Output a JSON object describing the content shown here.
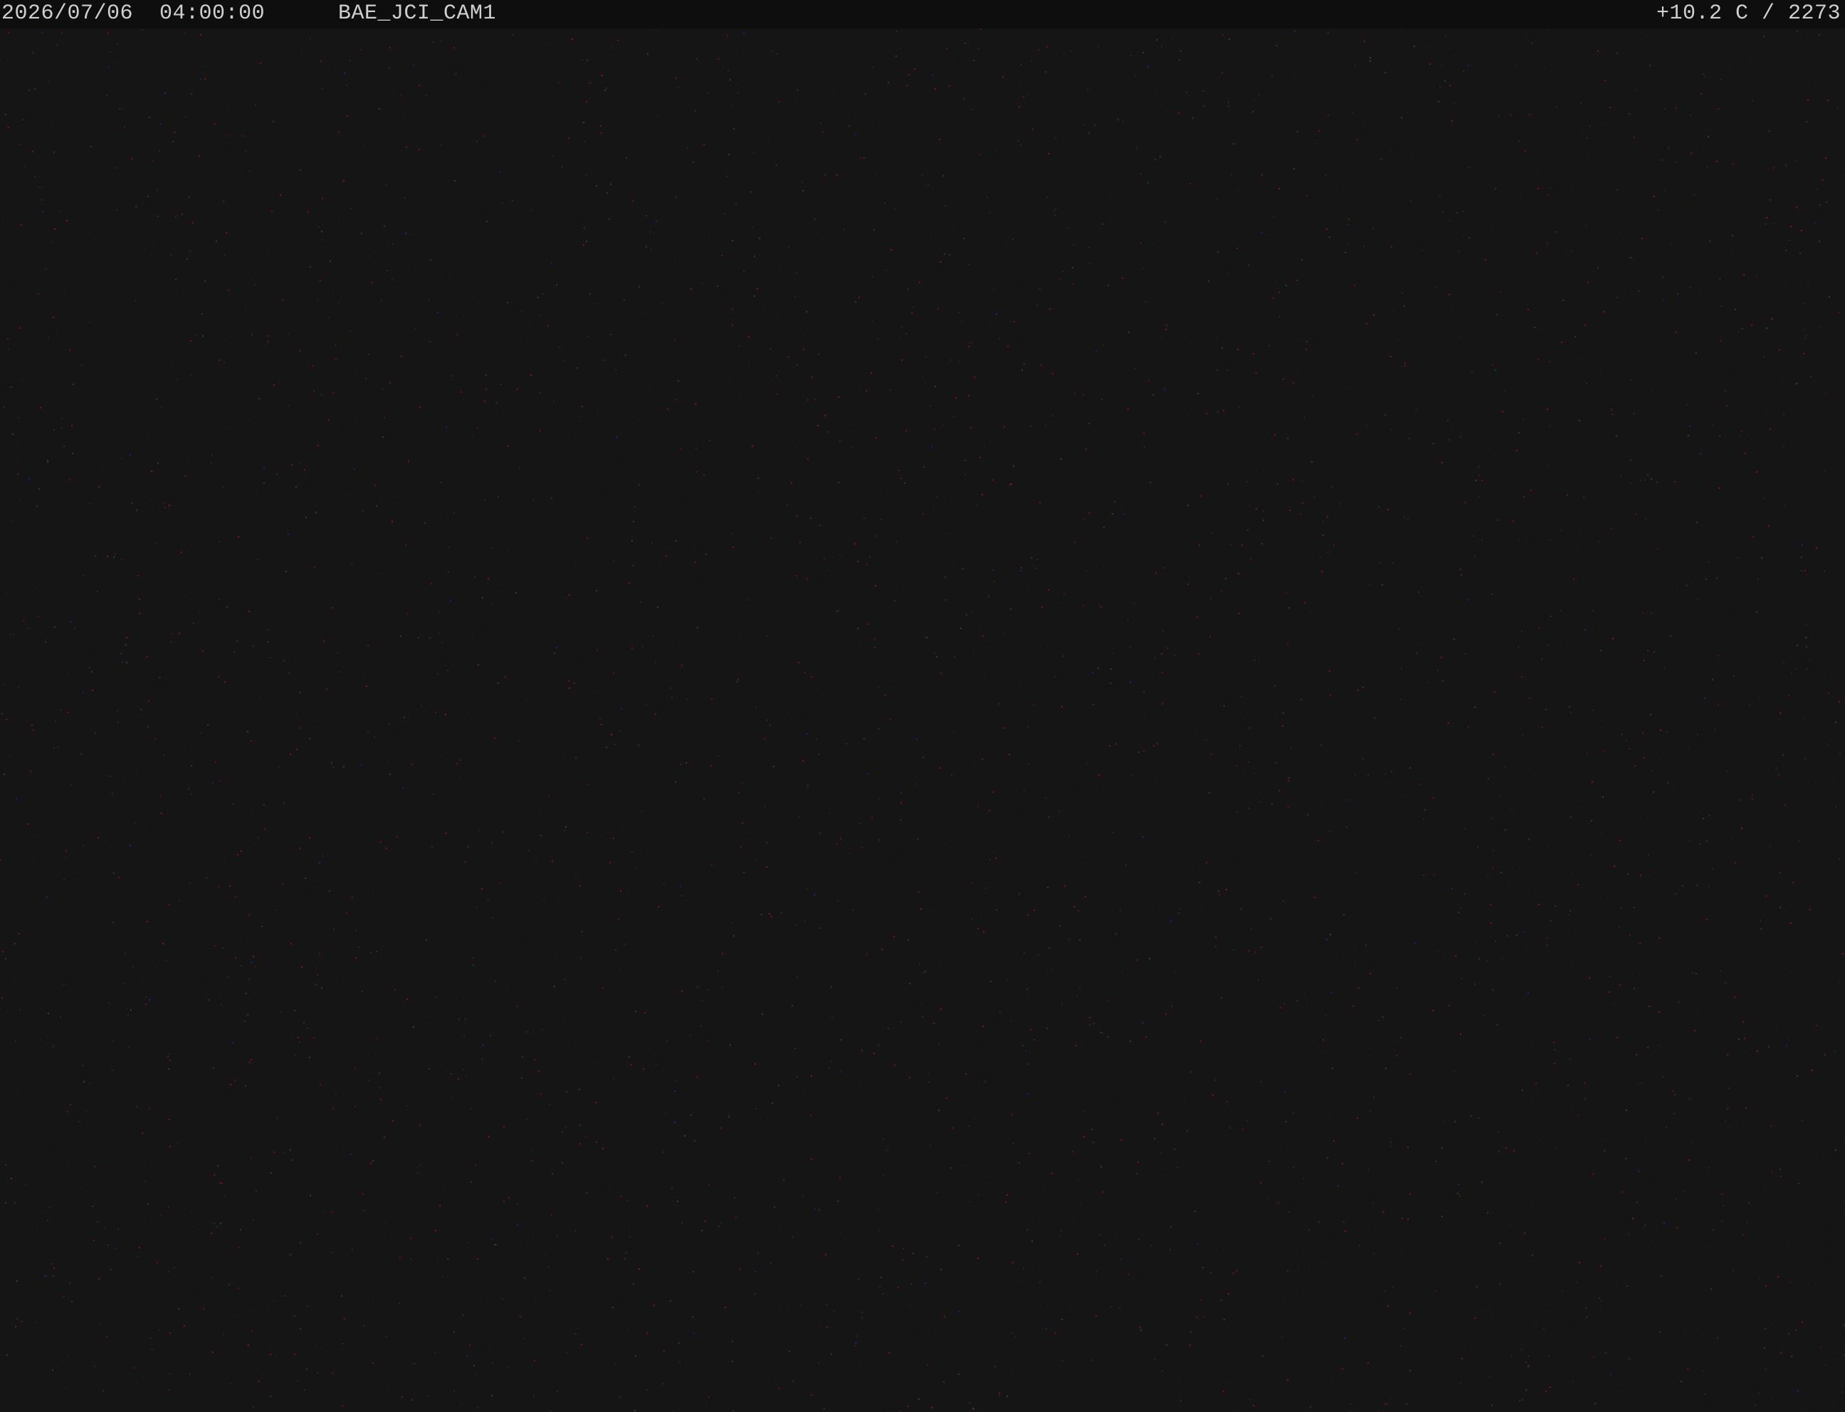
{
  "osd": {
    "date": "2026/07/06",
    "time": "04:00:00",
    "camera_id": "BAE_JCI_CAM1",
    "sensor_readout": "+10.2 C / 2273"
  },
  "colors": {
    "background": "#151515",
    "overlay_bar": "#0e0e0e",
    "overlay_text": "#cfcfcf",
    "noise_red": "#a01828",
    "noise_green": "#2f5a2f",
    "noise_blue": "#2a2a9a"
  }
}
